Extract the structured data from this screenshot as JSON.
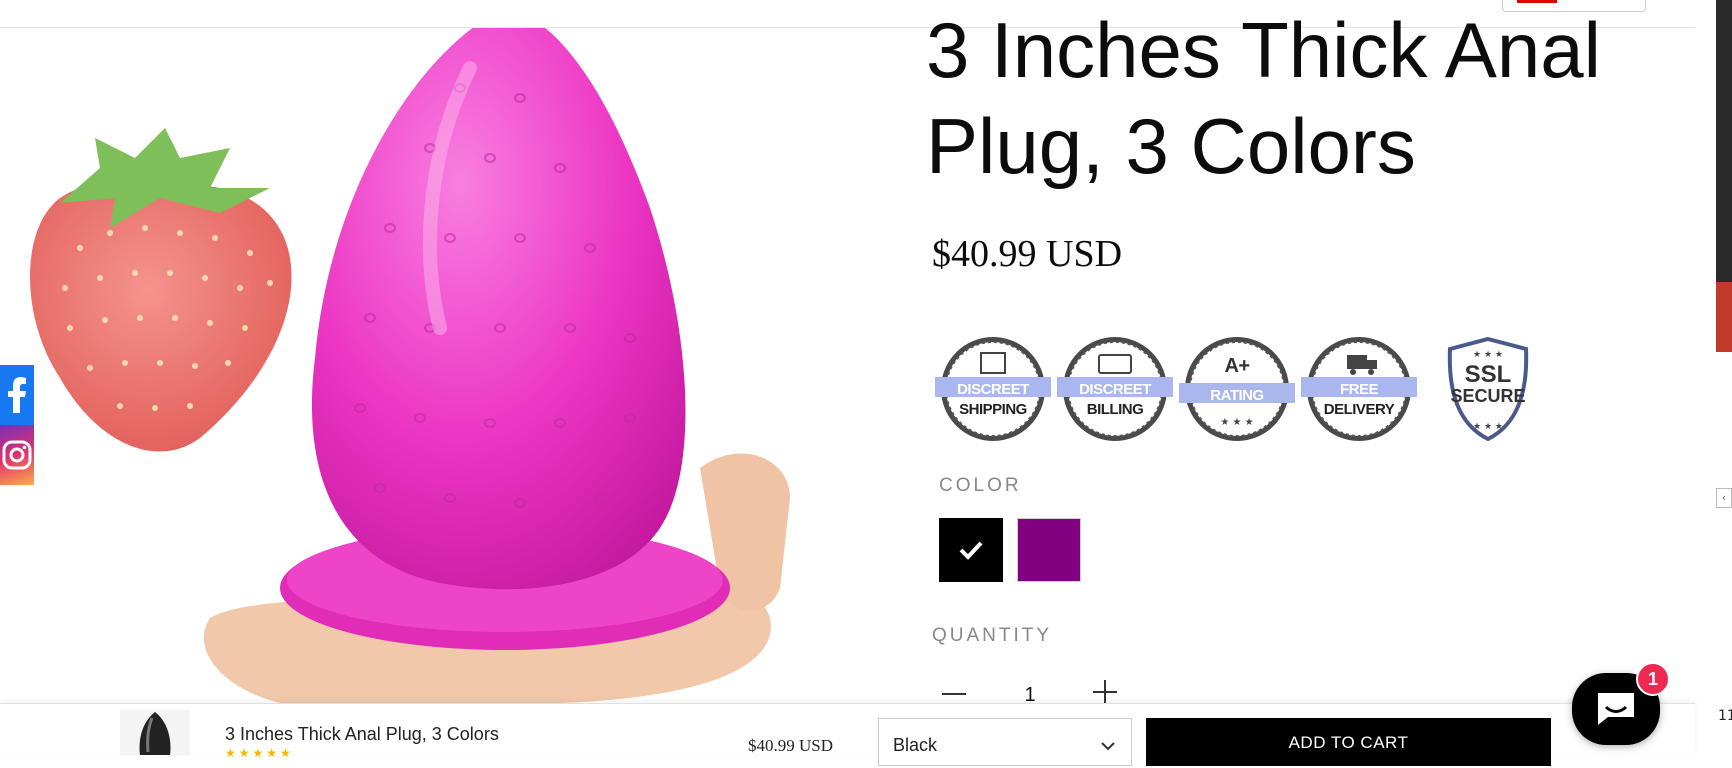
{
  "product": {
    "title": "3 Inches Thick Anal Plug, 3 Colors",
    "price": "$40.99 USD"
  },
  "trust_badges": [
    {
      "icon": "box-icon",
      "line1": "DISCREET",
      "line2": "SHIPPING"
    },
    {
      "icon": "card-icon",
      "line1": "DISCREET",
      "line2": "BILLING"
    },
    {
      "icon": "stars-icon",
      "line1": "A+",
      "line2": "RATING"
    },
    {
      "icon": "truck-icon",
      "line1": "FREE",
      "line2": "DELIVERY"
    },
    {
      "icon": "shield-icon",
      "line1": "SSL",
      "line2": "SECURE"
    }
  ],
  "color": {
    "label": "COLOR",
    "options": [
      {
        "name": "Black",
        "hex": "#000000",
        "selected": true
      },
      {
        "name": "Purple",
        "hex": "#800080",
        "selected": false
      }
    ]
  },
  "quantity": {
    "label": "QUANTITY",
    "value": "1"
  },
  "sticky_bar": {
    "title": "3 Inches Thick Anal Plug, 3 Colors",
    "price": "$40.99 USD",
    "selected_variant": "Black",
    "add_to_cart_label": "ADD TO CART"
  },
  "chat": {
    "unread_count": "1"
  },
  "edge": {
    "text": "11"
  },
  "colors": {
    "accent_button": "#000000",
    "badge_band": "#a9b7ee",
    "chat_badge": "#ee2a52",
    "facebook": "#1778f2",
    "product_pink": "#ee3ec7"
  }
}
